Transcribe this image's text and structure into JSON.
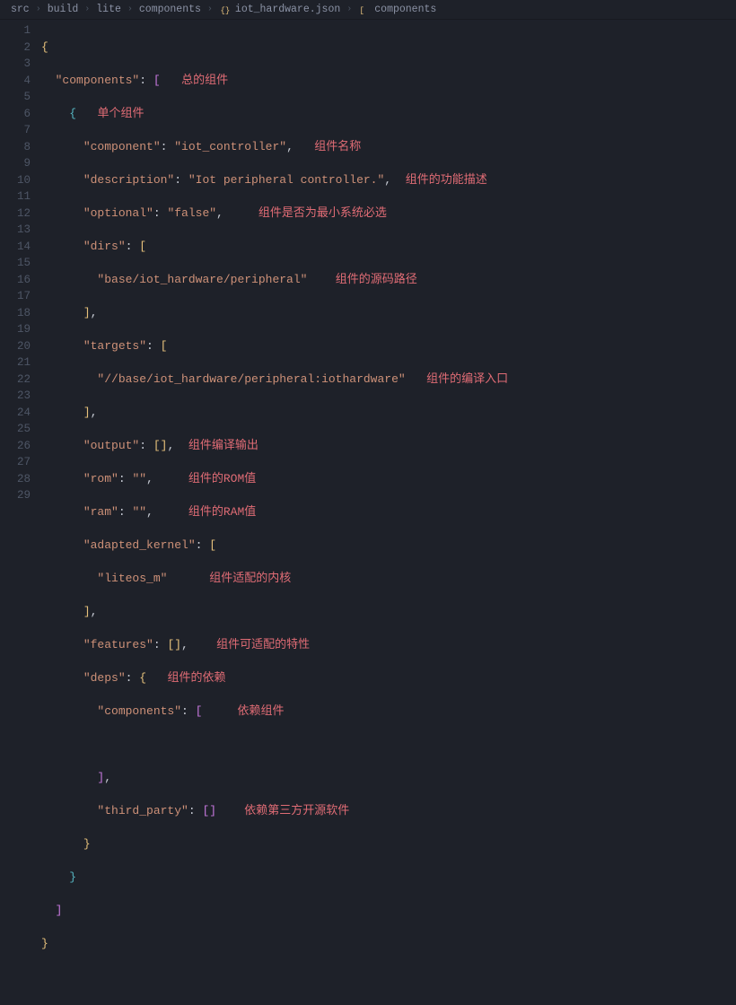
{
  "breadcrumbs": {
    "b1": "src",
    "b2": "build",
    "b3": "lite",
    "b4": "components",
    "b5": "iot_hardware.json",
    "b6": "components"
  },
  "gutter": {
    "l1": "1",
    "l2": "2",
    "l3": "3",
    "l4": "4",
    "l5": "5",
    "l6": "6",
    "l7": "7",
    "l8": "8",
    "l9": "9",
    "l10": "10",
    "l11": "11",
    "l12": "12",
    "l13": "13",
    "l14": "14",
    "l15": "15",
    "l16": "16",
    "l17": "17",
    "l18": "18",
    "l19": "19",
    "l20": "20",
    "l21": "21",
    "l22": "22",
    "l23": "23",
    "l24": "24",
    "l25": "25",
    "l26": "26",
    "l27": "27",
    "l28": "28",
    "l29": "29"
  },
  "code": {
    "k_components": "\"components\"",
    "c_components": "总的组件",
    "c_single": "单个组件",
    "k_component": "\"component\"",
    "v_component": "\"iot_controller\"",
    "c_name": "组件名称",
    "k_description": "\"description\"",
    "v_description": "\"Iot peripheral controller.\"",
    "c_description": "组件的功能描述",
    "k_optional": "\"optional\"",
    "v_optional": "\"false\"",
    "c_optional": "组件是否为最小系统必选",
    "k_dirs": "\"dirs\"",
    "v_dir": "\"base/iot_hardware/peripheral\"",
    "c_srcpath": "组件的源码路径",
    "k_targets": "\"targets\"",
    "v_target": "\"//base/iot_hardware/peripheral:iothardware\"",
    "c_target": "组件的编译入口",
    "k_output": "\"output\"",
    "c_output": "组件编译输出",
    "k_rom": "\"rom\"",
    "v_empty": "\"\"",
    "c_rom": "组件的ROM值",
    "k_ram": "\"ram\"",
    "c_ram": "组件的RAM值",
    "k_adapted": "\"adapted_kernel\"",
    "v_liteos": "\"liteos_m\"",
    "c_kernel": "组件适配的内核",
    "k_features": "\"features\"",
    "c_features": "组件可适配的特性",
    "k_deps": "\"deps\"",
    "c_deps": "组件的依赖",
    "k_deps_components": "\"components\"",
    "c_depcomp": "依赖组件",
    "k_third": "\"third_party\"",
    "c_third": "依赖第三方开源软件"
  }
}
